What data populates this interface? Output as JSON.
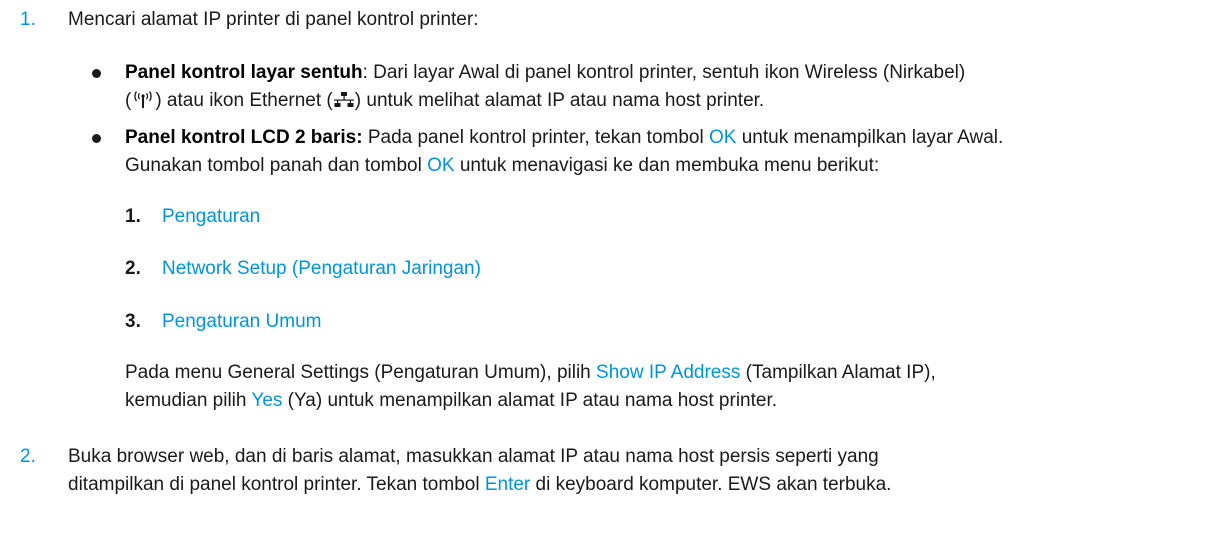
{
  "step1": {
    "number": "1.",
    "text": "Mencari alamat IP printer di panel kontrol printer:"
  },
  "bullet1": {
    "bold": "Panel kontrol layar sentuh",
    "line1_rest": ": Dari layar Awal di panel kontrol printer, sentuh ikon Wireless (Nirkabel)",
    "l2_open": "(",
    "l2_mid": ") atau ikon Ethernet (",
    "l2_end": ") untuk melihat alamat IP atau nama host printer.",
    "icons": [
      "wireless-icon",
      "ethernet-icon"
    ]
  },
  "bullet2": {
    "bold": "Panel kontrol LCD 2 baris:",
    "t1": " Pada panel kontrol printer, tekan tombol ",
    "ok": "OK",
    "t2": " untuk menampilkan layar Awal.",
    "t3": "Gunakan tombol panah dan tombol ",
    "ok2": "OK",
    "t4": " untuk menavigasi ke dan membuka menu berikut:"
  },
  "substeps": [
    {
      "number": "1.",
      "label": "Pengaturan"
    },
    {
      "number": "2.",
      "label": "Network Setup (Pengaturan Jaringan)"
    },
    {
      "number": "3.",
      "label": "Pengaturan Umum"
    }
  ],
  "note": {
    "a": "Pada menu General Settings (Pengaturan Umum), pilih ",
    "b": "Show IP Address",
    "c": " (Tampilkan Alamat IP),",
    "d": "kemudian pilih ",
    "e": "Yes",
    "f": " (Ya) untuk menampilkan alamat IP atau nama host printer."
  },
  "step2": {
    "number": "2.",
    "a": "Buka browser web, dan di baris alamat, masukkan alamat IP atau nama host persis seperti yang",
    "b": "ditampilkan di panel kontrol printer. Tekan tombol ",
    "c": "Enter",
    "d": " di keyboard komputer. EWS akan terbuka."
  },
  "colors": {
    "accent": "#0096d6",
    "text": "#1a1a1a"
  }
}
